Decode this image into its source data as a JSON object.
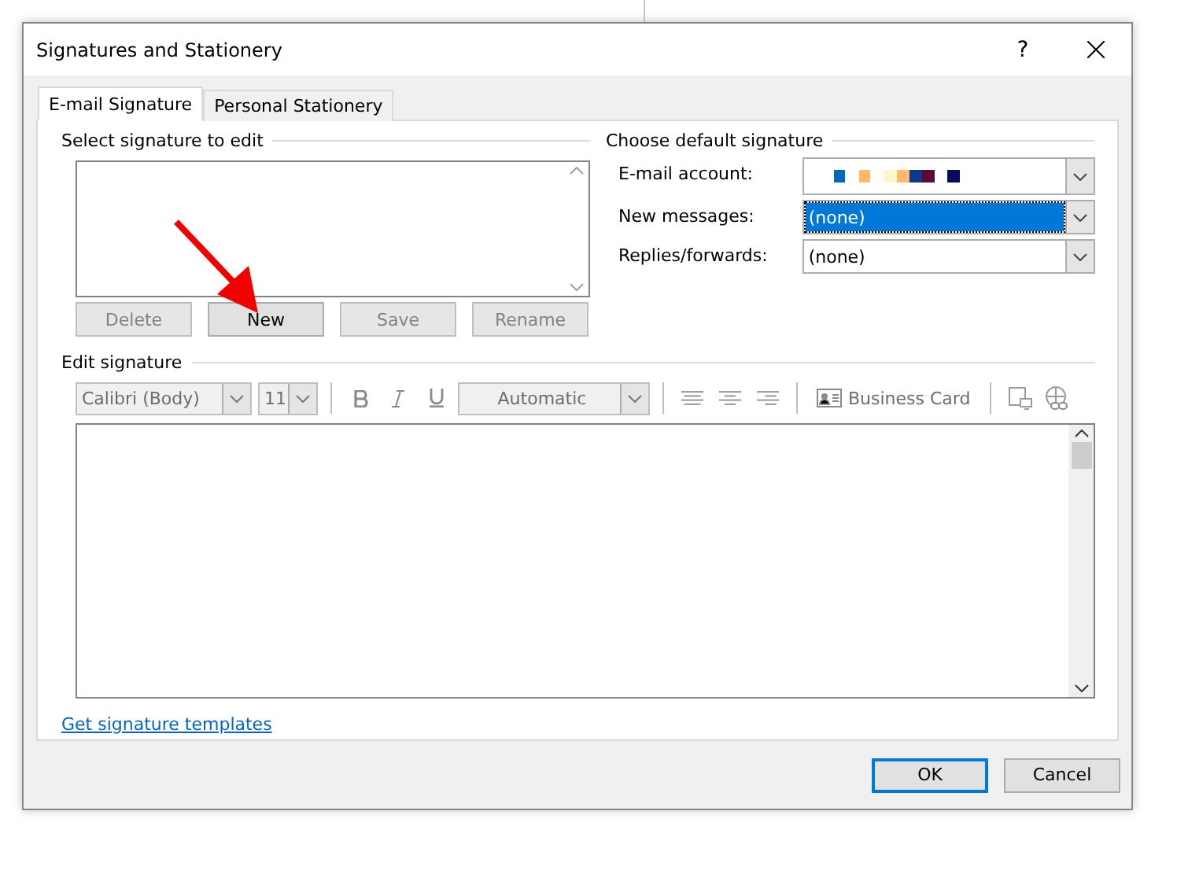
{
  "window": {
    "title": "Signatures and Stationery",
    "help": "?"
  },
  "tabs": [
    {
      "label": "E-mail Signature",
      "selected": true
    },
    {
      "label": "Personal Stationery",
      "selected": false
    }
  ],
  "select_signature": {
    "heading": "Select signature to edit",
    "buttons": [
      {
        "label": "Delete",
        "disabled": true
      },
      {
        "label": "New",
        "disabled": false
      },
      {
        "label": "Save",
        "disabled": true
      },
      {
        "label": "Rename",
        "disabled": true
      }
    ]
  },
  "default_signature": {
    "heading": "Choose default signature",
    "fields": [
      {
        "label": "E-mail account:",
        "kind": "redacted",
        "selected": false
      },
      {
        "label": "New messages:",
        "value": "(none)",
        "kind": "text",
        "selected": true
      },
      {
        "label": "Replies/forwards:",
        "value": "(none)",
        "kind": "text",
        "selected": false
      }
    ]
  },
  "edit_signature": {
    "heading": "Edit signature",
    "font": "Calibri (Body)",
    "size": "11",
    "font_color_label": "Automatic",
    "business_card": "Business Card"
  },
  "link": "Get signature templates",
  "buttons": [
    {
      "label": "OK",
      "default": true
    },
    {
      "label": "Cancel",
      "default": false
    }
  ]
}
